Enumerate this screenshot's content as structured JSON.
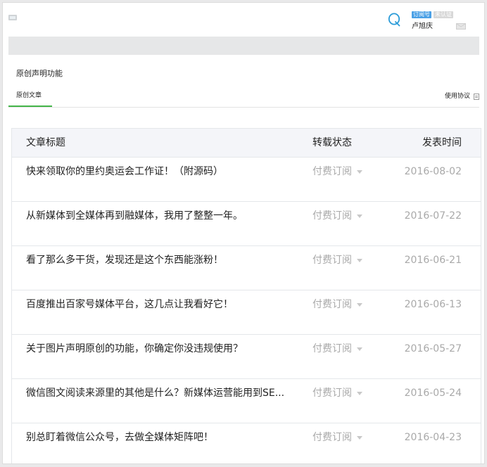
{
  "header": {
    "account_type_badge": "订阅号",
    "verification_badge": "未认证",
    "account_name": "卢旭庆"
  },
  "page": {
    "section_title": "原创声明功能",
    "tab_label": "原创文章",
    "usage_link": "使用协议"
  },
  "table": {
    "columns": [
      "文章标题",
      "转载状态",
      "发表时间"
    ],
    "rows": [
      {
        "title": "快来领取你的里约奥运会工作证！（附源码）",
        "status": "付费订阅",
        "date": "2016-08-02"
      },
      {
        "title": "从新媒体到全媒体再到融媒体，我用了整整一年。",
        "status": "付费订阅",
        "date": "2016-07-22"
      },
      {
        "title": "看了那么多干货，发现还是这个东西能涨粉！",
        "status": "付费订阅",
        "date": "2016-06-21"
      },
      {
        "title": "百度推出百家号媒体平台，这几点让我看好它！",
        "status": "付费订阅",
        "date": "2016-06-13"
      },
      {
        "title": "关于图片声明原创的功能，你确定你没违规使用？",
        "status": "付费订阅",
        "date": "2016-05-27"
      },
      {
        "title": "微信图文阅读来源里的其他是什么？新媒体运营能用到SE...",
        "status": "付费订阅",
        "date": "2016-05-24"
      },
      {
        "title": "别总盯着微信公众号，去做全媒体矩阵吧！",
        "status": "付费订阅",
        "date": "2016-04-23"
      }
    ]
  },
  "colors": {
    "accent_green": "#44b549",
    "badge_blue": "#4aa0e6",
    "muted_text": "#a9a9a9"
  },
  "icons": [
    "logo-icon",
    "brand-q-icon",
    "mail-icon",
    "document-icon",
    "dropdown-caret-icon"
  ]
}
